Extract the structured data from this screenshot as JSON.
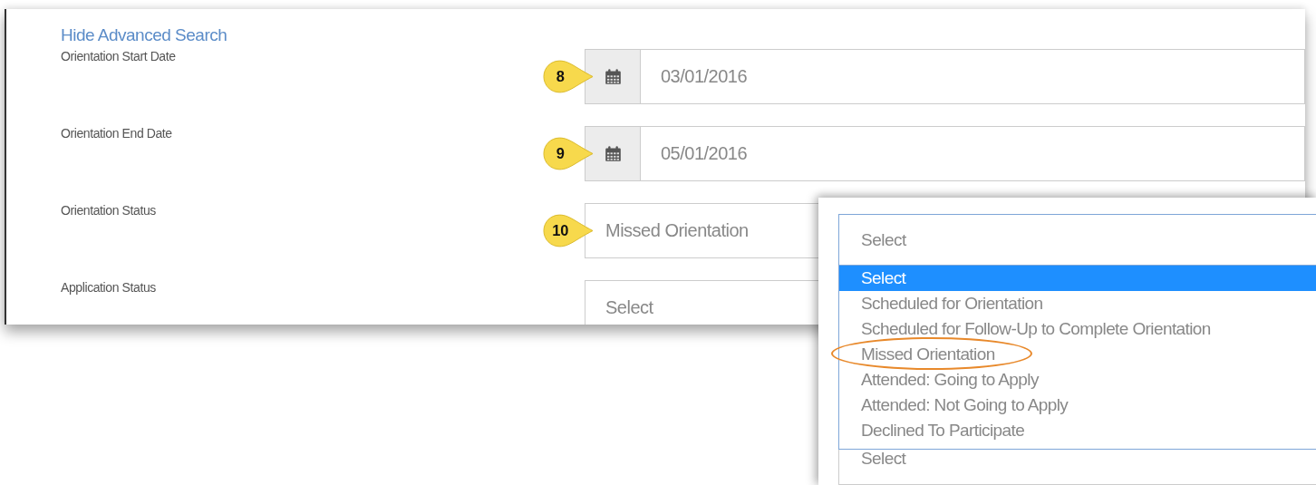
{
  "link": "Hide Advanced Search",
  "fields": [
    {
      "kind": "date",
      "label": "Orientation Start Date",
      "value": "03/01/2016",
      "callout": "8"
    },
    {
      "kind": "date",
      "label": "Orientation End Date",
      "value": "05/01/2016",
      "callout": "9"
    },
    {
      "kind": "select",
      "label": "Orientation Status",
      "value": "Missed Orientation",
      "callout": "10"
    },
    {
      "kind": "select",
      "label": "Application Status",
      "value": "Select"
    }
  ],
  "dropdown": {
    "value": "Select",
    "options": [
      {
        "label": "Select",
        "selected": true,
        "circled": false
      },
      {
        "label": "Scheduled for Orientation",
        "selected": false,
        "circled": false
      },
      {
        "label": "Scheduled for Follow-Up to Complete Orientation",
        "selected": false,
        "circled": false
      },
      {
        "label": "Missed Orientation",
        "selected": false,
        "circled": true
      },
      {
        "label": "Attended: Going to Apply",
        "selected": false,
        "circled": false
      },
      {
        "label": "Attended: Not Going to Apply",
        "selected": false,
        "circled": false
      },
      {
        "label": "Declined To Participate",
        "selected": false,
        "circled": false
      }
    ],
    "next_field_value": "Select"
  }
}
